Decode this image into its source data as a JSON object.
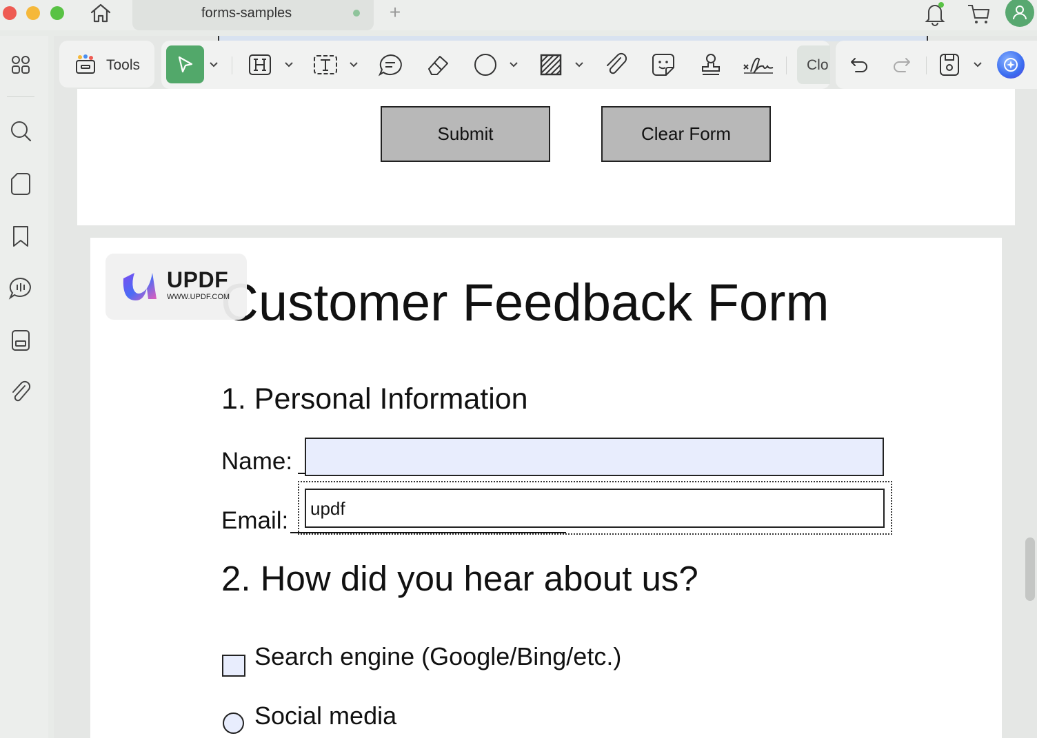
{
  "window": {
    "tab_title": "forms-samples",
    "new_tab_symbol": "+"
  },
  "toolbar": {
    "tools_label": "Tools",
    "clo_label": "Clo"
  },
  "page1": {
    "submit_label": "Submit",
    "clear_label": "Clear Form"
  },
  "watermark": {
    "brand": "UPDF",
    "url": "WWW.UPDF.COM"
  },
  "form": {
    "title": "Customer Feedback Form",
    "section1": "1. Personal Information",
    "name_label": "Name:",
    "name_value": "",
    "email_label": "Email:",
    "email_value": "updf",
    "section2": "2. How did you hear about us?",
    "option_checkbox": "Search engine (Google/Bing/etc.)",
    "option_radio": "Social media"
  },
  "colors": {
    "accent": "#52a86a",
    "field_fill": "#e8edfd",
    "button_fill": "#b8b8b8"
  }
}
